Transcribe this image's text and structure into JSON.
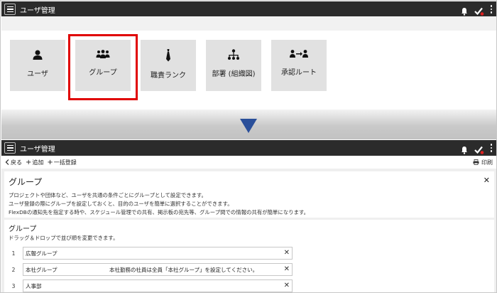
{
  "app": {
    "title": "ユーザ管理"
  },
  "tiles": [
    {
      "label": "ユーザ",
      "icon": "user-icon"
    },
    {
      "label": "グループ",
      "icon": "group-icon"
    },
    {
      "label": "職責ランク",
      "icon": "necktie-icon"
    },
    {
      "label": "部署 (組織図)",
      "icon": "org-chart-icon"
    },
    {
      "label": "承認ルート",
      "icon": "approval-route-icon"
    }
  ],
  "toolbar": {
    "back": "戻る",
    "add": "追加",
    "bulk_register": "一括登録",
    "print": "印刷"
  },
  "group_page": {
    "heading": "グループ",
    "description": [
      "プロジェクトや団体など、ユーザを共通の条件ごとにグループとして設定できます。",
      "ユーザ登録の際にグループを設定しておくと、目的のユーザを簡単に選択することができます。",
      "FlexDBの通知先を指定する時や、スケジュール管理での共有、掲示板の宛先等、グループ間での情報の共有が簡単になります。"
    ],
    "list_heading": "グループ",
    "list_hint": "ドラッグ＆ドロップで並び順を変更できます。",
    "rows": [
      {
        "num": "1",
        "name": "広報グループ",
        "note": ""
      },
      {
        "num": "2",
        "name": "本社グループ",
        "note": "本社勤務の社員は全員「本社グループ」を設定してください。"
      },
      {
        "num": "3",
        "name": "人事部",
        "note": ""
      }
    ]
  },
  "colors": {
    "titlebar": "#2b2b2b",
    "highlight": "#e00000",
    "arrow": "#2a4f9a",
    "tile": "#e1e1e1"
  }
}
